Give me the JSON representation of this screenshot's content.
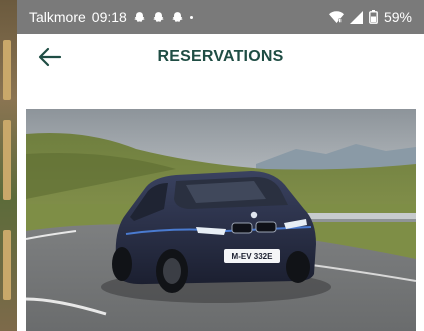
{
  "status_bar": {
    "carrier": "Talkmore",
    "time": "09:18",
    "battery": "59%",
    "icons": [
      "snapchat-icon",
      "snapchat-icon",
      "snapchat-icon",
      "wifi-icon",
      "signal-icon",
      "battery-icon"
    ]
  },
  "header": {
    "title": "RESERVATIONS",
    "back_icon": "arrow-left-icon"
  },
  "hero_image": {
    "subject": "car-photo",
    "plate": "M-EV 332E"
  },
  "colors": {
    "title": "#1f4d44",
    "back_arrow": "#1f4d44",
    "status_bar": "#7a7a7a"
  }
}
